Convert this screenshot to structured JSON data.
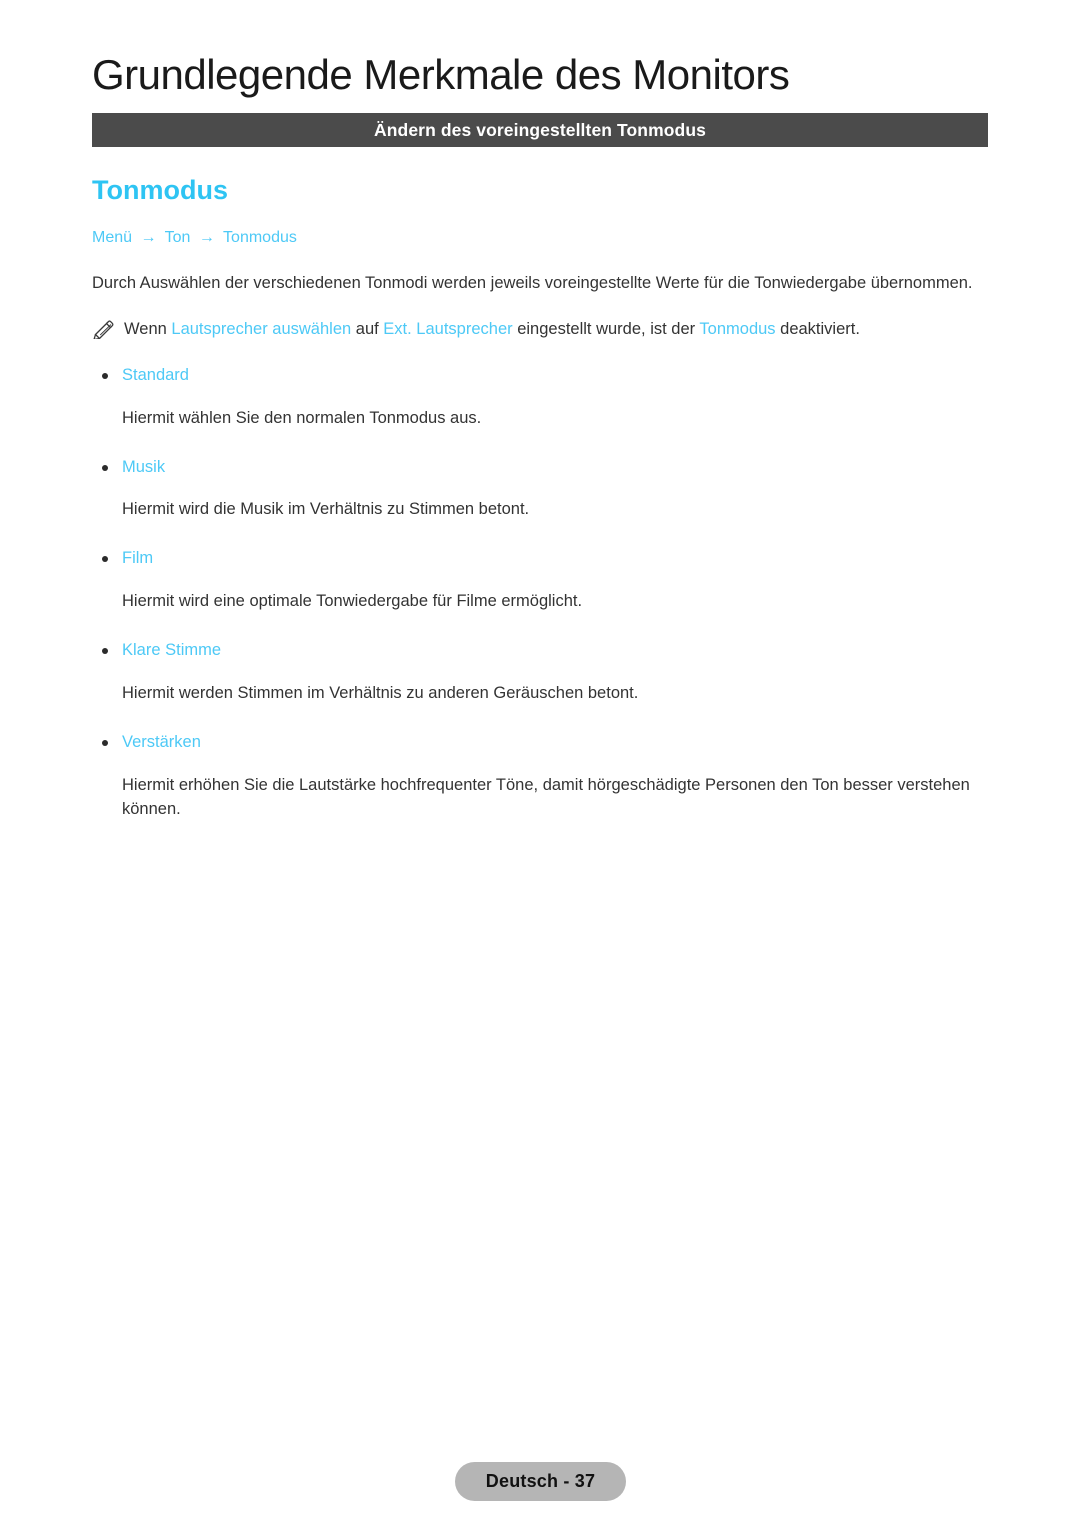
{
  "header": {
    "chapter_title": "Grundlegende Merkmale des Monitors",
    "section_bar_label": "Ändern des voreingestellten Tonmodus",
    "bar_color": "#4b4b4b"
  },
  "content": {
    "feature_heading": "Tonmodus",
    "accent_color": "#4dc9f6",
    "breadcrumb": {
      "items": [
        "Menü",
        "Ton",
        "Tonmodus"
      ],
      "separator": "→"
    },
    "intro_paragraph": "Durch Auswählen der verschiedenen Tonmodi werden jeweils voreingestellte Werte für die Tonwiedergabe übernommen.",
    "note": {
      "icon": "pencil-note-icon",
      "segments": [
        {
          "text": "Wenn ",
          "style": "plain"
        },
        {
          "text": "Lautsprecher auswählen",
          "style": "link"
        },
        {
          "text": " auf ",
          "style": "plain"
        },
        {
          "text": "Ext. Lautsprecher",
          "style": "link"
        },
        {
          "text": " eingestellt wurde, ist der ",
          "style": "plain"
        },
        {
          "text": "Tonmodus",
          "style": "link"
        },
        {
          "text": " deaktiviert.",
          "style": "plain"
        }
      ]
    },
    "options": [
      {
        "label": "Standard",
        "description": "Hiermit wählen Sie den normalen Tonmodus aus."
      },
      {
        "label": "Musik",
        "description": "Hiermit wird die Musik im Verhältnis zu Stimmen betont."
      },
      {
        "label": "Film",
        "description": "Hiermit wird eine optimale Tonwiedergabe für Filme ermöglicht."
      },
      {
        "label": "Klare Stimme",
        "description": "Hiermit werden Stimmen im Verhältnis zu anderen Geräuschen betont."
      },
      {
        "label": "Verstärken",
        "description": "Hiermit erhöhen Sie die Lautstärke hochfrequenter Töne, damit hörgeschädigte Personen den Ton besser verstehen können."
      }
    ]
  },
  "footer": {
    "page_label": "Deutsch - 37",
    "pill_color": "#b5b5b5"
  }
}
